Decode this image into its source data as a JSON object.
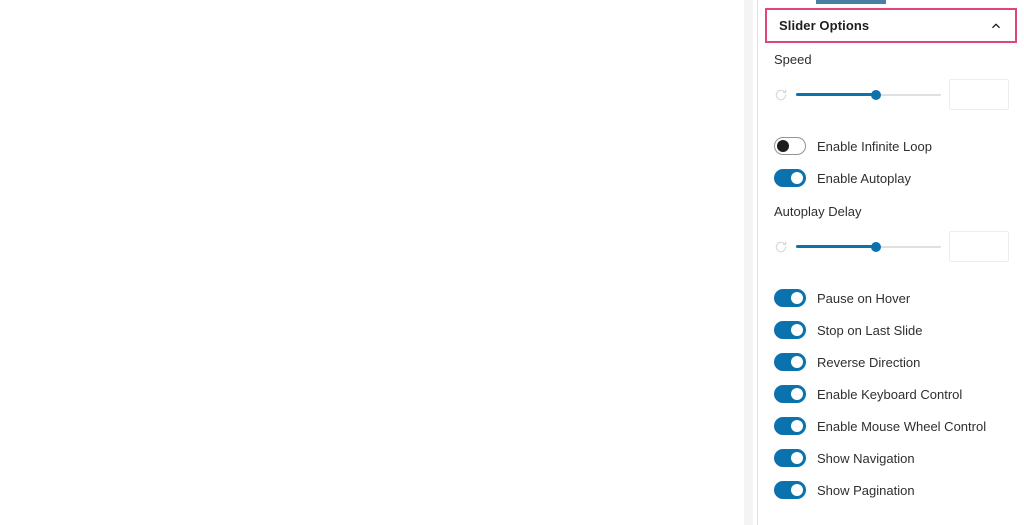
{
  "panel": {
    "title": "Slider Options",
    "collapse_icon": "chevron-up-icon",
    "expanded": true,
    "accent_focus_color": "#e0457b",
    "accent_control_color": "#0b72ad",
    "tab_indicator_color": "#4a7fa5"
  },
  "speed": {
    "label": "Speed",
    "reset_icon": "reset-circular-arrow-icon",
    "slider_percent": 55,
    "input_value": "",
    "input_placeholder": ""
  },
  "autoplay_delay": {
    "label": "Autoplay Delay",
    "reset_icon": "reset-circular-arrow-icon",
    "slider_percent": 55,
    "input_value": "",
    "input_placeholder": ""
  },
  "toggles_group_1": [
    {
      "label": "Enable Infinite Loop",
      "state": "off"
    },
    {
      "label": "Enable Autoplay",
      "state": "on"
    }
  ],
  "toggles_group_2": [
    {
      "label": "Pause on Hover",
      "state": "on"
    },
    {
      "label": "Stop on Last Slide",
      "state": "on"
    },
    {
      "label": "Reverse Direction",
      "state": "on"
    },
    {
      "label": "Enable Keyboard Control",
      "state": "on"
    },
    {
      "label": "Enable Mouse Wheel Control",
      "state": "on"
    },
    {
      "label": "Show Navigation",
      "state": "on"
    },
    {
      "label": "Show Pagination",
      "state": "on"
    }
  ],
  "scrollbar": {
    "thumb_color": "#bdbdbd",
    "track_color": "#f4f4f4"
  }
}
